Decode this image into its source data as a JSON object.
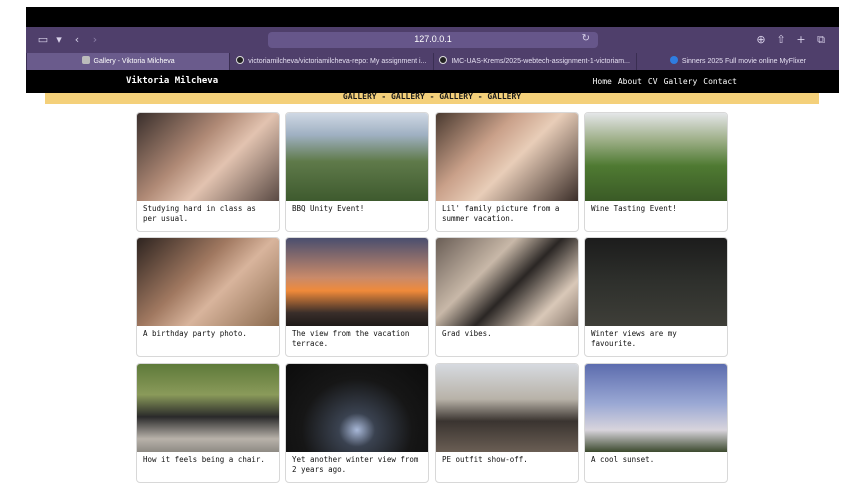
{
  "browser": {
    "address": "127.0.0.1",
    "tabs": [
      {
        "label": "Gallery - Viktoria Milcheva",
        "icon": "page-icon",
        "active": true
      },
      {
        "label": "victoriamilcheva/victoriamilcheva-repo: My assignment i...",
        "icon": "github-icon",
        "active": false
      },
      {
        "label": "IMC-UAS-Krems/2025-webtech-assignment-1-victoriam...",
        "icon": "github-icon",
        "active": false
      },
      {
        "label": "Sinners 2025 Full movie online MyFlixer",
        "icon": "myflixer-icon",
        "active": false
      }
    ]
  },
  "nav": {
    "brand": "Viktoria Milcheva",
    "links": [
      "Home",
      "About",
      "CV",
      "Gallery",
      "Contact"
    ]
  },
  "banner": {
    "text": "GALLERY - GALLERY - GALLERY - GALLERY"
  },
  "gallery": {
    "items": [
      {
        "caption": "Studying hard in class as per usual."
      },
      {
        "caption": "BBQ Unity Event!"
      },
      {
        "caption": "Lil' family picture from a summer vacation."
      },
      {
        "caption": "Wine Tasting Event!"
      },
      {
        "caption": "A birthday party photo."
      },
      {
        "caption": "The view from the vacation terrace."
      },
      {
        "caption": "Grad vibes."
      },
      {
        "caption": "Winter views are my favourite."
      },
      {
        "caption": "How it feels being a chair."
      },
      {
        "caption": "Yet another winter view from 2 years ago."
      },
      {
        "caption": "PE outfit show-off."
      },
      {
        "caption": "A cool sunset."
      }
    ]
  }
}
